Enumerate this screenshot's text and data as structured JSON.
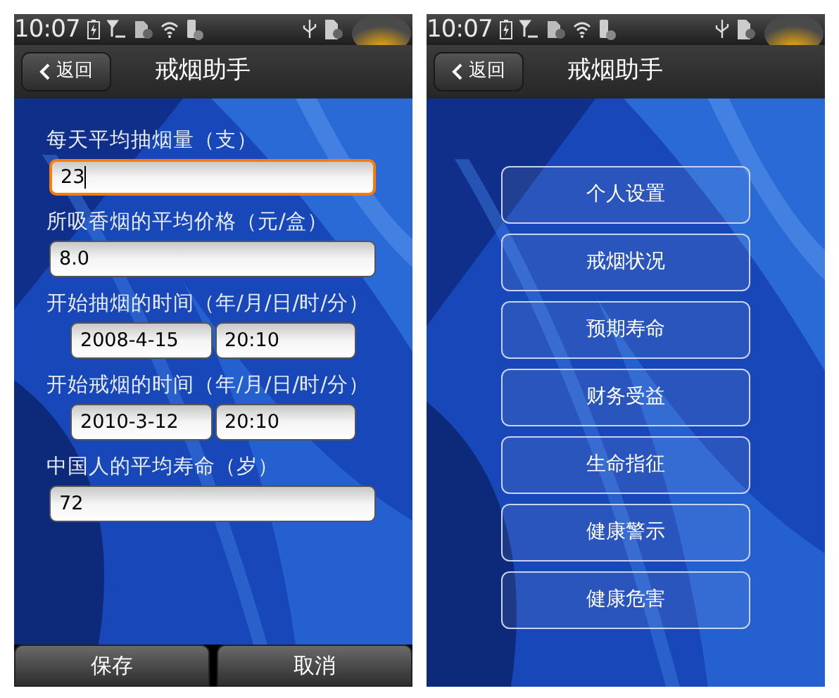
{
  "screens": [
    {
      "kind": "form",
      "status_bar": {
        "time": "10:07"
      },
      "title_bar": {
        "back": "返回",
        "title": "戒烟助手"
      },
      "fields": [
        {
          "label": "每天平均抽烟量（支）",
          "inputs": [
            {
              "value": "23",
              "focused": true
            }
          ]
        },
        {
          "label": "所吸香烟的平均价格（元/盒）",
          "inputs": [
            {
              "value": "8.0",
              "focused": false
            }
          ]
        },
        {
          "label": "开始抽烟的时间（年/月/日/时/分）",
          "inputs": [
            {
              "value": "2008-4-15",
              "focused": false
            },
            {
              "value": "20:10",
              "focused": false
            }
          ]
        },
        {
          "label": "开始戒烟的时间（年/月/日/时/分）",
          "inputs": [
            {
              "value": "2010-3-12",
              "focused": false
            },
            {
              "value": "20:10",
              "focused": false
            }
          ]
        },
        {
          "label": "中国人的平均寿命（岁）",
          "inputs": [
            {
              "value": "72",
              "focused": false
            }
          ]
        }
      ],
      "buttons": [
        "保存",
        "取消"
      ]
    },
    {
      "kind": "menu",
      "status_bar": {
        "time": "10:07"
      },
      "title_bar": {
        "back": "返回",
        "title": "戒烟助手"
      },
      "menu": [
        "个人设置",
        "戒烟状况",
        "预期寿命",
        "财务受益",
        "生命指征",
        "健康警示",
        "健康危害"
      ]
    }
  ]
}
